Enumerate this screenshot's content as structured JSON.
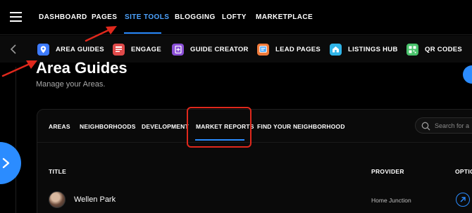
{
  "top_nav": {
    "items": [
      {
        "label": "DASHBOARD",
        "active": false
      },
      {
        "label": "PAGES",
        "active": false
      },
      {
        "label": "SITE TOOLS",
        "active": true
      },
      {
        "label": "BLOGGING",
        "active": false
      },
      {
        "label": "LOFTY",
        "active": false
      },
      {
        "label": "MARKETPLACE",
        "active": false
      }
    ]
  },
  "sub_nav": {
    "items": [
      {
        "label": "AREA GUIDES",
        "icon": "map-pin-icon",
        "color": "#3d7bff"
      },
      {
        "label": "ENGAGE",
        "icon": "engage-icon",
        "color": "#e04a4a"
      },
      {
        "label": "GUIDE CREATOR",
        "icon": "guide-creator-icon",
        "color": "#8a4fd6"
      },
      {
        "label": "LEAD PAGES",
        "icon": "lead-pages-icon",
        "color": "#f07a3a"
      },
      {
        "label": "LISTINGS HUB",
        "icon": "listings-hub-icon",
        "color": "#2fb4e8"
      },
      {
        "label": "QR CODES",
        "icon": "qr-code-icon",
        "color": "#49c26b"
      }
    ]
  },
  "page": {
    "title": "Area Guides",
    "subtitle": "Manage your Areas."
  },
  "tabs": [
    {
      "label": "AREAS",
      "active": false
    },
    {
      "label": "NEIGHBORHOODS",
      "active": false
    },
    {
      "label": "DEVELOPMENT",
      "active": false
    },
    {
      "label": "MARKET REPORTS",
      "active": true
    },
    {
      "label": "FIND YOUR NEIGHBORHOOD",
      "active": false
    }
  ],
  "search": {
    "placeholder": "Search for a"
  },
  "table": {
    "columns": [
      "TITLE",
      "PROVIDER",
      "OPTIO"
    ],
    "rows": [
      {
        "title": "Wellen Park",
        "provider": "Home Junction"
      }
    ]
  },
  "colors": {
    "accent": "#2b8cff",
    "annotation": "#e0281c",
    "background": "#000000"
  }
}
